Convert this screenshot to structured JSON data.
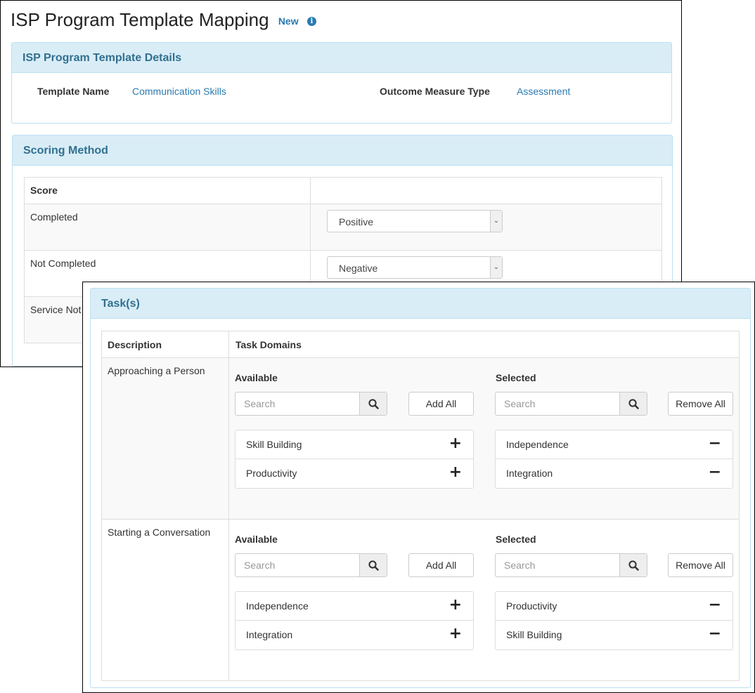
{
  "header": {
    "title": "ISP Program Template Mapping",
    "badge": "New",
    "info_icon": "info-circle-icon"
  },
  "details": {
    "heading": "ISP Program Template Details",
    "template_name_label": "Template Name",
    "template_name_value": "Communication Skills",
    "outcome_label": "Outcome Measure Type",
    "outcome_value": "Assessment"
  },
  "scoring": {
    "heading": "Scoring Method",
    "col_score": "Score",
    "rows": [
      {
        "label": "Completed",
        "selected": "Positive"
      },
      {
        "label": "Not Completed",
        "selected": "Negative"
      },
      {
        "label": "Service Not"
      }
    ]
  },
  "tasks": {
    "heading": "Task(s)",
    "col_description": "Description",
    "col_domains": "Task Domains",
    "available_label": "Available",
    "selected_label": "Selected",
    "search_placeholder": "Search",
    "add_all": "Add All",
    "remove_all": "Remove All",
    "rows": [
      {
        "description": "Approaching a Person",
        "available": [
          "Skill Building",
          "Productivity"
        ],
        "selected": [
          "Independence",
          "Integration"
        ]
      },
      {
        "description": "Starting a Conversation",
        "available": [
          "Independence",
          "Integration"
        ],
        "selected": [
          "Productivity",
          "Skill Building"
        ]
      }
    ]
  },
  "colors": {
    "panel_heading_bg": "#d9edf7",
    "panel_heading_text": "#31708f",
    "link": "#2a7ab0"
  }
}
